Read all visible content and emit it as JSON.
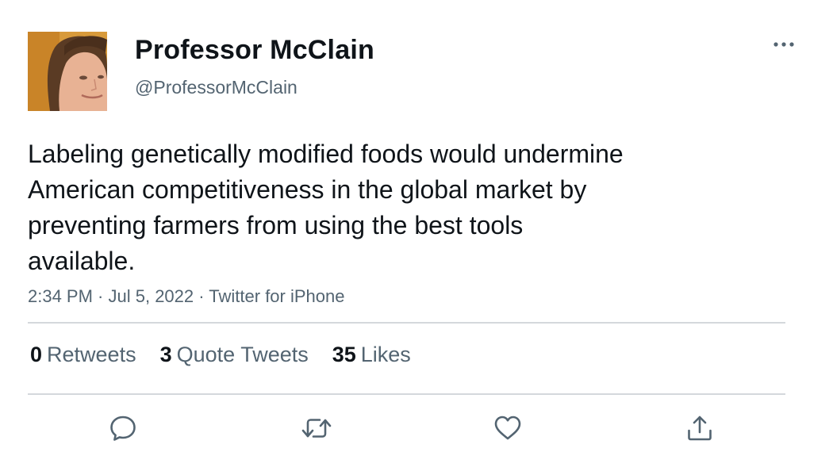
{
  "author": {
    "display_name": "Professor McClain",
    "handle": "@ProfessorMcClain"
  },
  "tweet": {
    "text_lines": [
      "Labeling genetically modified foods would undermine",
      "American competitiveness in the global market by",
      "preventing farmers from using the best tools",
      "available."
    ],
    "time": "2:34 PM",
    "date": "Jul 5, 2022",
    "source": "Twitter for iPhone",
    "separator": " · "
  },
  "stats": {
    "retweets_count": "0",
    "retweets_label": "Retweets",
    "quotes_count": "3",
    "quotes_label": "Quote Tweets",
    "likes_count": "35",
    "likes_label": "Likes"
  },
  "icons": {
    "more": "more-horizontal-icon",
    "reply": "reply-bubble-icon",
    "retweet": "retweet-arrows-icon",
    "like": "heart-icon",
    "share": "share-upload-icon"
  },
  "colors": {
    "primary_text": "#0f1419",
    "secondary_text": "#536471",
    "divider": "#d4d8dc",
    "icon": "#536471"
  }
}
